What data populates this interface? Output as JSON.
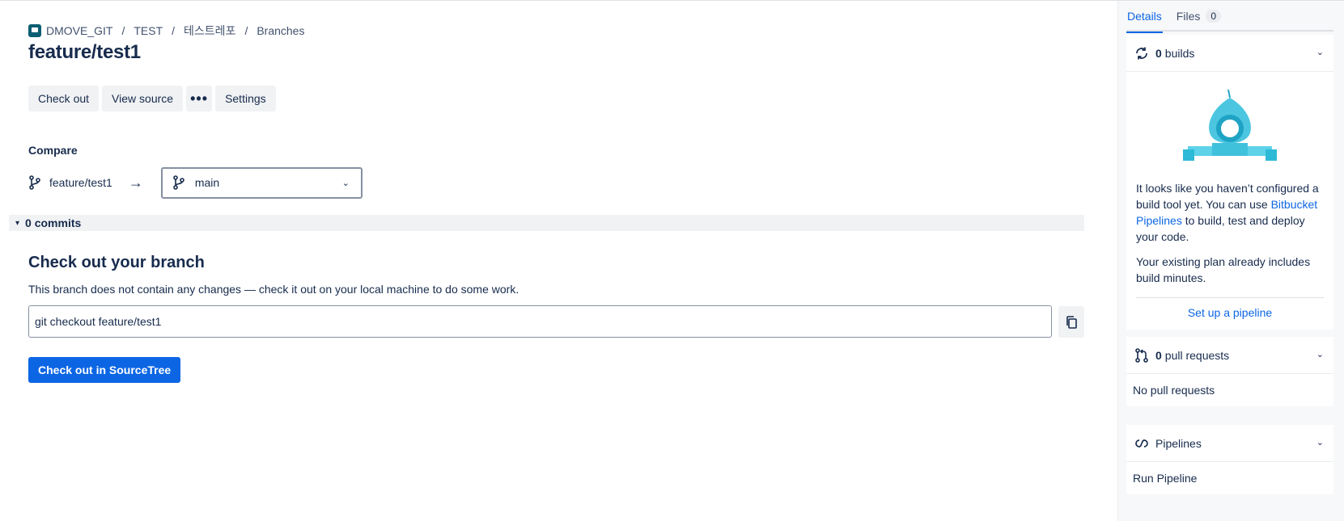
{
  "breadcrumb": {
    "items": [
      "DMOVE_GIT",
      "TEST",
      "테스트레포",
      "Branches"
    ],
    "separator": "/"
  },
  "page": {
    "title": "feature/test1"
  },
  "toolbar": {
    "checkout_label": "Check out",
    "view_source_label": "View source",
    "more_label": "•••",
    "settings_label": "Settings"
  },
  "compare": {
    "label": "Compare",
    "from_branch": "feature/test1",
    "to_branch": "main"
  },
  "commits": {
    "label": "0 commits"
  },
  "checkout_section": {
    "title": "Check out your branch",
    "description": "This branch does not contain any changes — check it out on your local machine to do some work.",
    "command": "git checkout feature/test1",
    "sourcetree_label": "Check out in SourceTree"
  },
  "sidebar": {
    "tabs": [
      {
        "label": "Details",
        "active": true
      },
      {
        "label": "Files",
        "count": "0"
      }
    ],
    "builds": {
      "count": "0",
      "label": "builds",
      "text_before_link": "It looks like you haven’t configured a build tool yet. You can use ",
      "link": "Bitbucket Pipelines",
      "text_after_link": " to build, test and deploy your code.",
      "plan_text": "Your existing plan already includes build minutes.",
      "setup_label": "Set up a pipeline"
    },
    "pull_requests": {
      "count": "0",
      "label": "pull requests",
      "empty_text": "No pull requests"
    },
    "pipelines": {
      "label": "Pipelines",
      "run_label": "Run Pipeline"
    }
  },
  "colors": {
    "primary": "#0c66e4",
    "text": "#172b4d",
    "button_bg": "#f1f2f4",
    "sidebar_bg": "#f7f8f9"
  }
}
